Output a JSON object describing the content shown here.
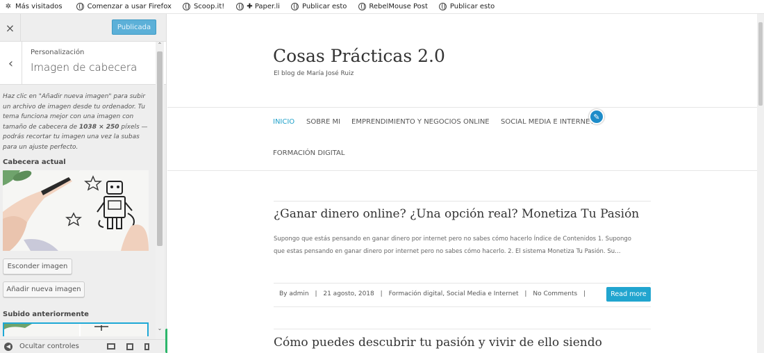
{
  "bookmarks": [
    {
      "label": "Más visitados",
      "icon": "gear-icon"
    },
    {
      "label": "Comenzar a usar Firefox",
      "icon": "globe-icon"
    },
    {
      "label": "Scoop.it!",
      "icon": "globe-icon"
    },
    {
      "label": "✚ Paper.li",
      "icon": "globe-icon"
    },
    {
      "label": "Publicar esto",
      "icon": "globe-icon"
    },
    {
      "label": "RebelMouse Post",
      "icon": "globe-icon"
    },
    {
      "label": "Publicar esto",
      "icon": "globe-icon"
    }
  ],
  "customizer": {
    "close_icon": "×",
    "publish_label": "Publicada",
    "back_icon": "‹",
    "breadcrumb": "Personalización",
    "section_title": "Imagen de cabecera",
    "description_parts": [
      "Haz clic en \"Añadir nueva imagen\" para subir un archivo de imagen desde tu ordenador. Tu tema funciona mejor con una imagen con tamaño de cabecera de ",
      "1038 × 250",
      " píxels — podrás recortar tu imagen una vez la subas para un ajuste perfecto."
    ],
    "current_header_label": "Cabecera actual",
    "hide_image_label": "Esconder imagen",
    "add_image_label": "Añadir nueva imagen",
    "previously_uploaded_label": "Subido anteriormente",
    "footer_label": "Ocultar controles",
    "colors": {
      "publish_bg": "#5cb0d8",
      "selected_border": "#1ea8d6",
      "footer_tab": "#2db66b"
    }
  },
  "site": {
    "title": "Cosas Prácticas 2.0",
    "tagline": "El blog de María José Ruiz",
    "nav": [
      "INICIO",
      "SOBRE MI",
      "EMPRENDIMIENTO Y NEGOCIOS ONLINE",
      "SOCIAL MEDIA E INTERNET",
      "FORMACIÓN DIGITAL"
    ],
    "nav_active_color": "#1ea0c9",
    "posts": [
      {
        "title": "¿Ganar dinero online? ¿Una opción real? Monetiza Tu Pasión",
        "excerpt": "Supongo que estás pensando en ganar dinero por internet pero no sabes cómo hacerlo          Índice de Contenidos 1. Supongo que estas pensando en  ganar dinero por internet pero no sabes cómo hacerlo.  2. El sistema Monetiza Tu Pasión.  Su…",
        "meta": {
          "author": "By admin",
          "date": "21 agosto, 2018",
          "categories": "Formación digital, Social Media e Internet",
          "comments": "No Comments"
        },
        "read_more": "Read more"
      },
      {
        "title": "Cómo puedes descubrir tu pasión y vivir de ello siendo"
      }
    ]
  }
}
